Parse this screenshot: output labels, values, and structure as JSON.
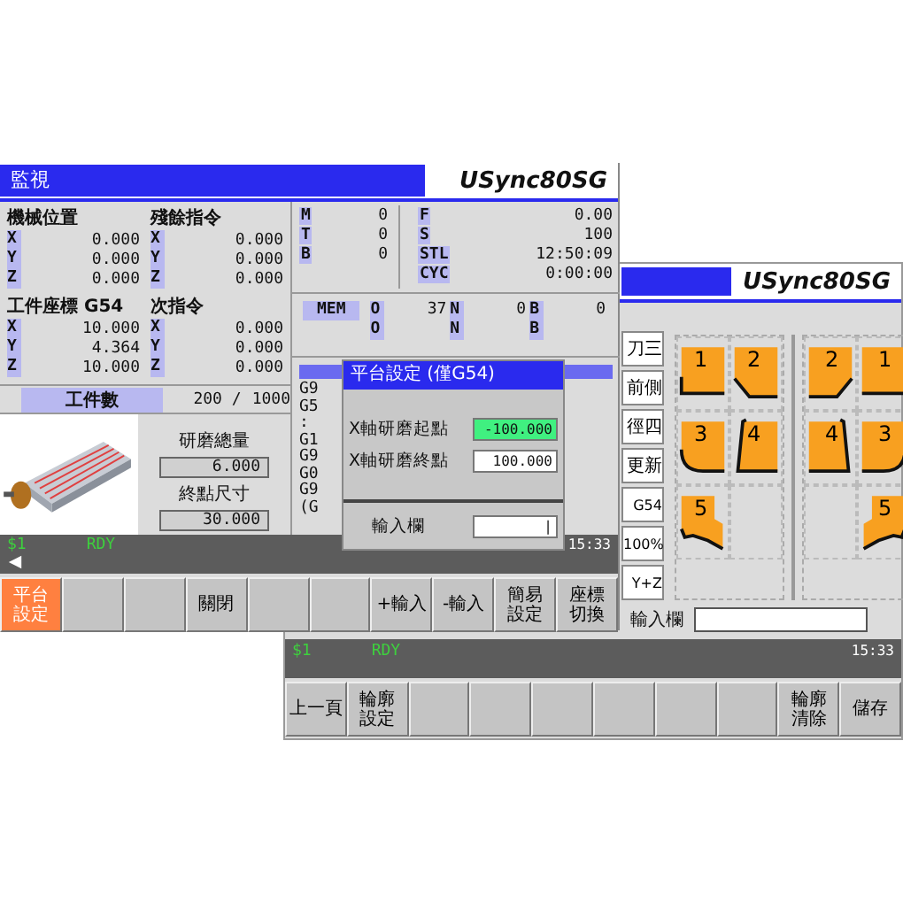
{
  "back_window": {
    "logo": "USync80SG",
    "side_tabs": [
      "刀三",
      "前側",
      "徑四",
      "更新",
      "G54",
      "100%",
      "Y+Z"
    ],
    "shape_groups": [
      [
        {
          "label": "1",
          "kind": "corner",
          "mirror": false
        },
        {
          "label": "2",
          "kind": "chamfer",
          "mirror": false
        },
        {
          "label": "3",
          "kind": "round",
          "mirror": false
        },
        {
          "label": "4",
          "kind": "taper",
          "mirror": false
        },
        {
          "label": "5",
          "kind": "step",
          "mirror": false
        },
        {
          "kind": "empty"
        }
      ],
      [
        {
          "label": "2",
          "kind": "chamfer",
          "mirror": true
        },
        {
          "label": "1",
          "kind": "corner",
          "mirror": true
        },
        {
          "label": "4",
          "kind": "taper",
          "mirror": true
        },
        {
          "label": "3",
          "kind": "round",
          "mirror": true
        },
        {
          "kind": "empty"
        },
        {
          "label": "5",
          "kind": "step",
          "mirror": true
        }
      ]
    ],
    "input": {
      "label": "輸入欄"
    },
    "status": {
      "channel": "$1",
      "state": "RDY",
      "time": "15:33"
    },
    "softkeys": [
      {
        "label": "上一頁",
        "selected": false
      },
      {
        "label": "輪廓設定",
        "selected": false
      },
      {
        "selected": false
      },
      {
        "selected": false
      },
      {
        "selected": false
      },
      {
        "selected": false
      },
      {
        "selected": false
      },
      {
        "selected": false
      },
      {
        "label": "輪廓清除",
        "selected": false
      },
      {
        "label": "儲存",
        "selected": false
      }
    ]
  },
  "front_window": {
    "title": "監視",
    "logo": "USync80SG",
    "positions": [
      {
        "title": "機械位置",
        "axes": [
          {
            "axis": "X",
            "value": "0.000"
          },
          {
            "axis": "Y",
            "value": "0.000"
          },
          {
            "axis": "Z",
            "value": "0.000"
          }
        ]
      },
      {
        "title": "殘餘指令",
        "axes": [
          {
            "axis": "X",
            "value": "0.000"
          },
          {
            "axis": "Y",
            "value": "0.000"
          },
          {
            "axis": "Z",
            "value": "0.000"
          }
        ]
      },
      {
        "title": "工件座標 G54",
        "axes": [
          {
            "axis": "X",
            "value": "10.000"
          },
          {
            "axis": "Y",
            "value": "4.364"
          },
          {
            "axis": "Z",
            "value": "10.000"
          }
        ]
      },
      {
        "title": "次指令",
        "axes": [
          {
            "axis": "X",
            "value": "0.000"
          },
          {
            "axis": "Y",
            "value": "0.000"
          },
          {
            "axis": "Z",
            "value": "0.000"
          }
        ]
      }
    ],
    "work_count": {
      "label": "工件數",
      "value": "200 /",
      "total": "1000"
    },
    "grind_total": {
      "label": "研磨總量",
      "value": "6.000"
    },
    "end_size": {
      "label": "終點尺寸",
      "value": "30.000"
    },
    "mtb": [
      {
        "key": "M",
        "value": "0"
      },
      {
        "key": "T",
        "value": "0"
      },
      {
        "key": "B",
        "value": "0"
      }
    ],
    "feed": [
      {
        "key": "F",
        "value": "0.00"
      },
      {
        "key": "S",
        "value": "100"
      },
      {
        "key": "STL",
        "value": "12:50:09"
      },
      {
        "key": "CYC",
        "value": "0:00:00"
      }
    ],
    "mem_label": "MEM",
    "mem_rows": [
      [
        {
          "key": "O",
          "value": "37"
        },
        {
          "key": "N",
          "value": "0"
        },
        {
          "key": "B",
          "value": "0"
        }
      ],
      [
        {
          "key": "O"
        },
        {
          "key": "N"
        },
        {
          "key": "B"
        }
      ]
    ],
    "program_lines": [
      "G9",
      "G5",
      ":",
      "G1",
      "G9",
      "G0",
      "G9",
      "(G"
    ],
    "status": {
      "channel": "$1",
      "state": "RDY",
      "time": "15:33"
    },
    "softkeys": [
      {
        "label": "平台設定",
        "selected": true
      },
      {
        "selected": false
      },
      {
        "selected": false
      },
      {
        "label": "關閉",
        "selected": false
      },
      {
        "selected": false
      },
      {
        "selected": false
      },
      {
        "label": "+輸入",
        "selected": false
      },
      {
        "label": "-輸入",
        "selected": false
      },
      {
        "label": "簡易設定",
        "selected": false
      },
      {
        "label": "座標切換",
        "selected": false
      }
    ]
  },
  "dialog": {
    "title": "平台設定 (僅G54)",
    "fields": [
      {
        "label": "X軸研磨起點",
        "value": "-100.000",
        "selected": true
      },
      {
        "label": "X軸研磨終點",
        "value": "100.000",
        "selected": false
      }
    ],
    "input": {
      "label": "輸入欄",
      "value": "|"
    }
  }
}
